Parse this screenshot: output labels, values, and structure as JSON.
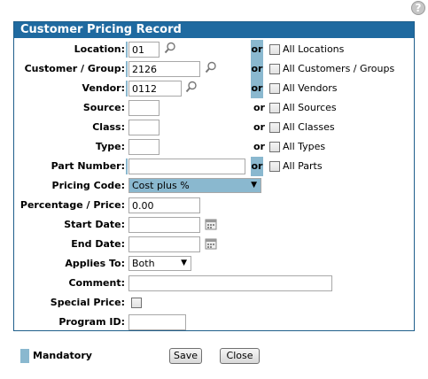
{
  "help": {
    "icon": "help-icon",
    "glyph": "?"
  },
  "panel": {
    "title": "Customer Pricing Record"
  },
  "form": {
    "location": {
      "label": "Location:",
      "value": "01",
      "or": "or",
      "all_label": "All Locations"
    },
    "customer_group": {
      "label": "Customer / Group:",
      "value": "2126",
      "or": "or",
      "all_label": "All Customers / Groups"
    },
    "vendor": {
      "label": "Vendor:",
      "value": "0112",
      "or": "or",
      "all_label": "All Vendors"
    },
    "source": {
      "label": "Source:",
      "value": "",
      "or": "or",
      "all_label": "All Sources"
    },
    "class": {
      "label": "Class:",
      "value": "",
      "or": "or",
      "all_label": "All Classes"
    },
    "type": {
      "label": "Type:",
      "value": "",
      "or": "or",
      "all_label": "All Types"
    },
    "part_number": {
      "label": "Part Number:",
      "value": "",
      "or": "or",
      "all_label": "All Parts"
    },
    "pricing_code": {
      "label": "Pricing Code:",
      "value": "Cost plus %"
    },
    "percentage_price": {
      "label": "Percentage / Price:",
      "value": "0.00"
    },
    "start_date": {
      "label": "Start Date:",
      "value": ""
    },
    "end_date": {
      "label": "End Date:",
      "value": ""
    },
    "applies_to": {
      "label": "Applies To:",
      "value": "Both"
    },
    "comment": {
      "label": "Comment:",
      "value": ""
    },
    "special_price": {
      "label": "Special Price:",
      "checked": false
    },
    "program_id": {
      "label": "Program ID:",
      "value": ""
    }
  },
  "footer": {
    "legend_label": "Mandatory",
    "save_label": "Save",
    "close_label": "Close"
  },
  "colors": {
    "header_bg": "#1f6aa0",
    "mandatory": "#8ab8cf"
  }
}
